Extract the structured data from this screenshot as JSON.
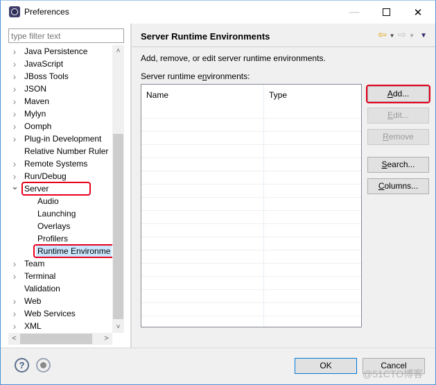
{
  "window": {
    "title": "Preferences",
    "controls": {
      "minimize": "—",
      "maximize": "",
      "close": "✕"
    }
  },
  "left": {
    "filter_placeholder": "type filter text",
    "tree": [
      {
        "label": "Java Persistence",
        "expandable": true,
        "expanded": false,
        "level": 0
      },
      {
        "label": "JavaScript",
        "expandable": true,
        "expanded": false,
        "level": 0
      },
      {
        "label": "JBoss Tools",
        "expandable": true,
        "expanded": false,
        "level": 0
      },
      {
        "label": "JSON",
        "expandable": true,
        "expanded": false,
        "level": 0
      },
      {
        "label": "Maven",
        "expandable": true,
        "expanded": false,
        "level": 0
      },
      {
        "label": "Mylyn",
        "expandable": true,
        "expanded": false,
        "level": 0
      },
      {
        "label": "Oomph",
        "expandable": true,
        "expanded": false,
        "level": 0
      },
      {
        "label": "Plug-in Development",
        "expandable": true,
        "expanded": false,
        "level": 0
      },
      {
        "label": "Relative Number Ruler",
        "expandable": false,
        "expanded": false,
        "level": 0
      },
      {
        "label": "Remote Systems",
        "expandable": true,
        "expanded": false,
        "level": 0
      },
      {
        "label": "Run/Debug",
        "expandable": true,
        "expanded": false,
        "level": 0
      },
      {
        "label": "Server",
        "expandable": true,
        "expanded": true,
        "level": 0,
        "highlighted": true
      },
      {
        "label": "Audio",
        "expandable": false,
        "expanded": false,
        "level": 1
      },
      {
        "label": "Launching",
        "expandable": false,
        "expanded": false,
        "level": 1
      },
      {
        "label": "Overlays",
        "expandable": false,
        "expanded": false,
        "level": 1
      },
      {
        "label": "Profilers",
        "expandable": false,
        "expanded": false,
        "level": 1
      },
      {
        "label": "Runtime Environme",
        "expandable": false,
        "expanded": false,
        "level": 1,
        "selected": true,
        "highlighted": true
      },
      {
        "label": "Team",
        "expandable": true,
        "expanded": false,
        "level": 0
      },
      {
        "label": "Terminal",
        "expandable": true,
        "expanded": false,
        "level": 0
      },
      {
        "label": "Validation",
        "expandable": false,
        "expanded": false,
        "level": 0
      },
      {
        "label": "Web",
        "expandable": true,
        "expanded": false,
        "level": 0
      },
      {
        "label": "Web Services",
        "expandable": true,
        "expanded": false,
        "level": 0
      },
      {
        "label": "XML",
        "expandable": true,
        "expanded": false,
        "level": 0
      }
    ],
    "scroll_glyphs": {
      "up": "˄",
      "down": "˅",
      "left": "<",
      "right": ">"
    }
  },
  "right": {
    "page_title": "Server Runtime Environments",
    "nav": {
      "back": "⇦",
      "forward": "⇨",
      "dropdown": "▼",
      "menu": "▼"
    },
    "description": "Add, remove, or edit server runtime environments.",
    "list_label_pre": "Server runtime e",
    "list_label_mnemonic": "n",
    "list_label_post": "vironments:",
    "table": {
      "columns": [
        "Name",
        "Type"
      ],
      "rows": []
    },
    "buttons": [
      {
        "id": "add",
        "mnemonic": "A",
        "rest": "dd...",
        "enabled": true,
        "highlighted": true
      },
      {
        "id": "edit",
        "mnemonic": "E",
        "rest": "dit...",
        "enabled": false
      },
      {
        "id": "remove",
        "mnemonic": "R",
        "rest": "emove",
        "enabled": false
      },
      {
        "id": "search",
        "mnemonic": "S",
        "rest": "earch...",
        "enabled": true
      },
      {
        "id": "columns",
        "mnemonic": "C",
        "rest": "olumns...",
        "enabled": true
      }
    ]
  },
  "footer": {
    "help_glyph": "?",
    "ok_label": "OK",
    "cancel_label": "Cancel",
    "watermark": "@51CTO博客"
  },
  "colors": {
    "highlight": "#e8001c",
    "selection": "#cce8ff",
    "default_button_border": "#0078d7"
  }
}
